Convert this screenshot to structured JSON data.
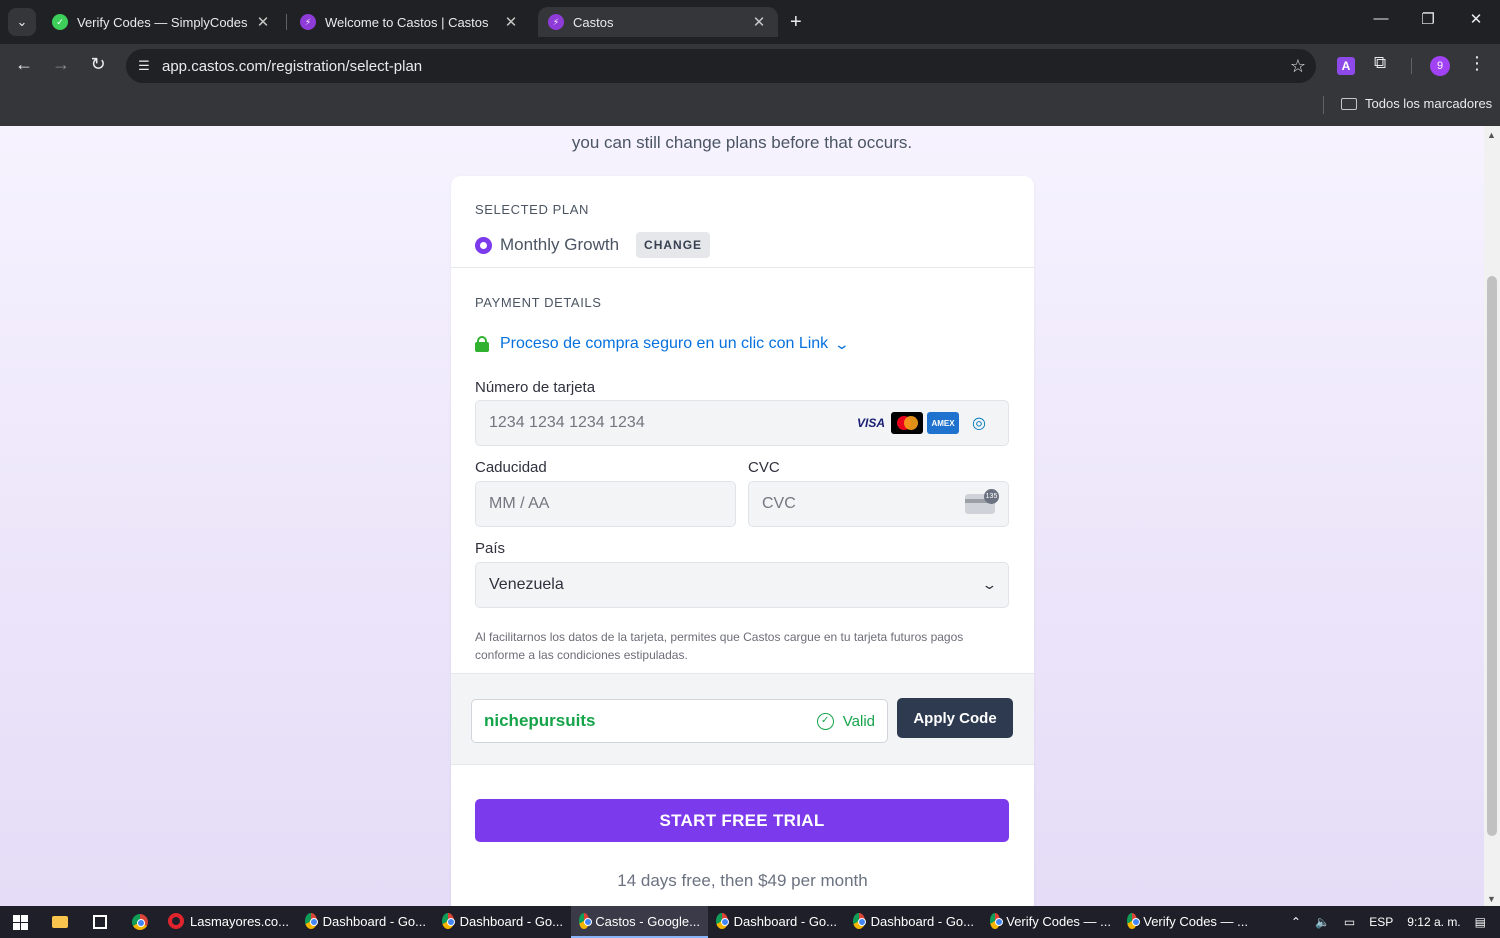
{
  "browser": {
    "tabs": [
      {
        "title": "Verify Codes — SimplyCodes",
        "active": false
      },
      {
        "title": "Welcome to Castos | Castos",
        "active": false
      },
      {
        "title": "Castos",
        "active": true
      }
    ],
    "url": "app.castos.com/registration/select-plan",
    "profile_initial": "9",
    "ext_letter": "A",
    "bookmarks_all": "Todos los marcadores"
  },
  "page": {
    "intro_text": "you can still change plans before that occurs.",
    "selected_plan": {
      "section_label": "SELECTED PLAN",
      "plan_name": "Monthly Growth",
      "change_label": "CHANGE"
    },
    "payment": {
      "section_label": "PAYMENT DETAILS",
      "link_text": "Proceso de compra seguro en un clic con Link",
      "card_number_label": "Número de tarjeta",
      "card_number_placeholder": "1234 1234 1234 1234",
      "brands": [
        "VISA",
        "Mastercard",
        "AMEX",
        "Diners"
      ],
      "expiry_label": "Caducidad",
      "expiry_placeholder": "MM / AA",
      "cvc_label": "CVC",
      "cvc_placeholder": "CVC",
      "cvc_badge": "135",
      "country_label": "País",
      "country_value": "Venezuela",
      "disclaimer": "Al facilitarnos los datos de la tarjeta, permites que Castos cargue en tu tarjeta futuros pagos conforme a las condiciones estipuladas."
    },
    "coupon": {
      "code": "nichepursuits",
      "status": "Valid",
      "apply_label": "Apply Code"
    },
    "cta": {
      "label": "START FREE TRIAL",
      "note": "14 days free, then $49 per month"
    }
  },
  "taskbar": {
    "items": [
      {
        "label": "Lasmayores.co...",
        "icon": "opera-icon",
        "active": false
      },
      {
        "label": "Dashboard - Go...",
        "icon": "chrome-icon",
        "active": false
      },
      {
        "label": "Dashboard - Go...",
        "icon": "chrome-icon",
        "active": false
      },
      {
        "label": "Castos - Google...",
        "icon": "chrome-icon",
        "active": true
      },
      {
        "label": "Dashboard - Go...",
        "icon": "chrome-icon",
        "active": false
      },
      {
        "label": "Dashboard - Go...",
        "icon": "chrome-icon",
        "active": false
      },
      {
        "label": "Verify Codes — ...",
        "icon": "chrome-icon",
        "active": false
      },
      {
        "label": "Verify Codes — ...",
        "icon": "chrome-icon",
        "active": false
      }
    ],
    "language": "ESP",
    "time": "9:12 a. m."
  },
  "colors": {
    "accent": "#7c3aed",
    "link": "#0570de",
    "valid": "#16a34a",
    "apply_button": "#2d3a4f"
  }
}
